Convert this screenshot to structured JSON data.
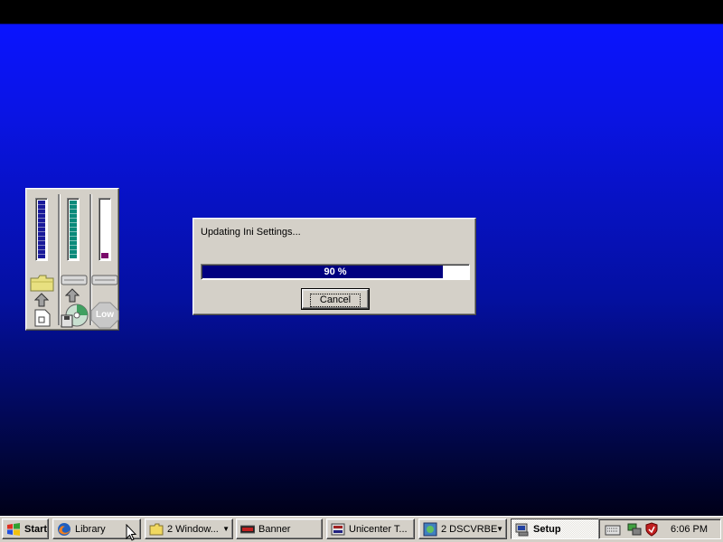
{
  "dialog": {
    "message": "Updating Ini Settings...",
    "progress_percent": 90,
    "progress_label": "90 %",
    "cancel_label": "Cancel"
  },
  "meters": {
    "folder_meter_level": 1.0,
    "disk_meter_level": 1.0,
    "memory_meter_level": 0.1,
    "low_label": "Low"
  },
  "taskbar": {
    "start_label": "Start",
    "items": [
      {
        "label": "Library",
        "icon": "firefox-icon"
      },
      {
        "label": "2 Window...",
        "icon": "folder-icon"
      },
      {
        "label": "Banner",
        "icon": "banner-icon"
      },
      {
        "label": "Unicenter T...",
        "icon": "unicenter-icon"
      },
      {
        "label": "2 DSCVRBE",
        "icon": "dscvrbe-icon"
      },
      {
        "label": "Setup",
        "icon": "setup-icon"
      }
    ],
    "clock": "6:06 PM"
  },
  "colors": {
    "desktop": "#0a14e6",
    "progress": "#000080",
    "face": "#d4d0c8"
  }
}
